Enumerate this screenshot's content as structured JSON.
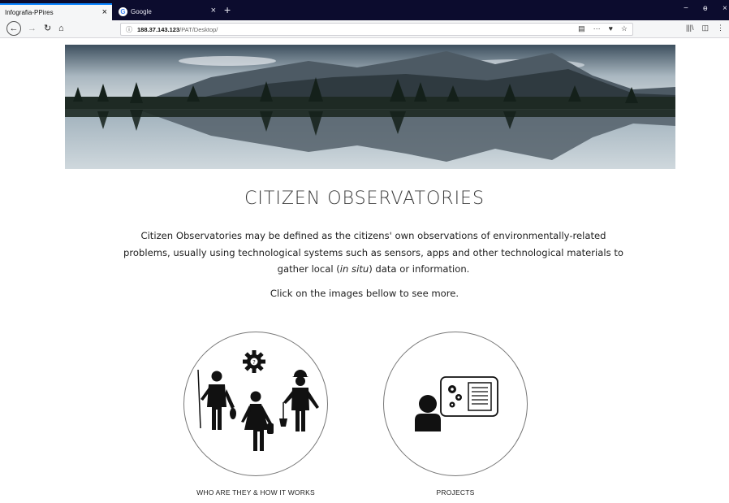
{
  "browser": {
    "tabs": [
      {
        "label": "Infografia-PPires",
        "active": true
      },
      {
        "label": "Google",
        "active": false
      }
    ],
    "new_tab": "+",
    "close_glyph": "×",
    "window_controls": [
      "−",
      "ɵ",
      "×"
    ],
    "url": {
      "host": "188.37.143.123",
      "path": "/PAT/Desktop/"
    },
    "url_actions": [
      "▤",
      "···",
      "♥",
      "☆"
    ],
    "toolbar_right": [
      "|||\\",
      "◫",
      "⋮"
    ]
  },
  "page": {
    "title": "CITIZEN OBSERVATORIES",
    "description_part1": "Citizen Observatories may be defined as the citizens' own observations of environmentally-related problems, usually using technological systems such as sensors, apps and other technological materials to gather local (",
    "description_italic": "in situ",
    "description_part2": ") data or information.",
    "hint": "Click on the images bellow to see more.",
    "cards": [
      {
        "label": "WHO ARE THEY & HOW IT WORKS",
        "icon": "people-icon"
      },
      {
        "label": "PROJECTS",
        "icon": "presentation-icon"
      }
    ]
  },
  "colors": {
    "tabbar": "#0c0c2e",
    "accent": "#0a84ff",
    "text": "#222222"
  }
}
